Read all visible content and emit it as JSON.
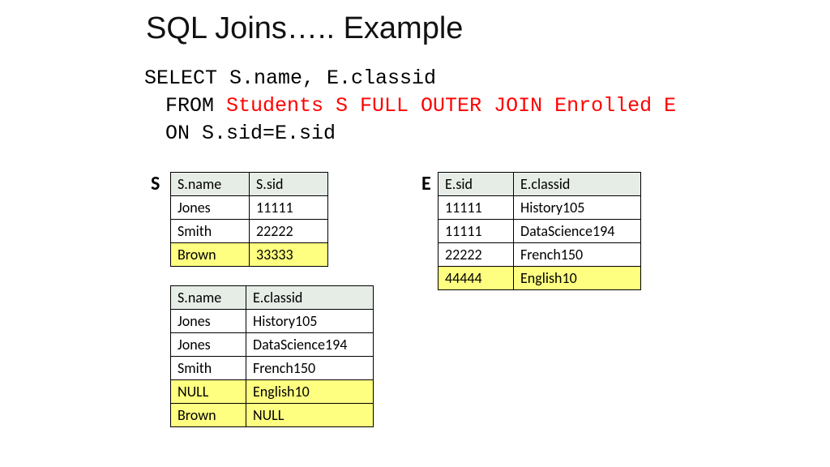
{
  "title": "SQL Joins….. Example",
  "code": {
    "select": "SELECT S.name, E.classid",
    "from_kw": "FROM ",
    "from_red": "Students S FULL OUTER JOIN Enrolled E",
    "on": "ON S.sid=E.sid"
  },
  "labels": {
    "s": "S",
    "e": "E"
  },
  "tables": {
    "students": {
      "headers": [
        "S.name",
        "S.sid"
      ],
      "rows": [
        {
          "cells": [
            "Jones",
            "11111"
          ],
          "hl": false
        },
        {
          "cells": [
            "Smith",
            "22222"
          ],
          "hl": false
        },
        {
          "cells": [
            "Brown",
            "33333"
          ],
          "hl": true
        }
      ]
    },
    "enrolled": {
      "headers": [
        "E.sid",
        "E.classid"
      ],
      "rows": [
        {
          "cells": [
            "11111",
            "History105"
          ],
          "hl": false
        },
        {
          "cells": [
            "11111",
            "DataScience194"
          ],
          "hl": false
        },
        {
          "cells": [
            "22222",
            "French150"
          ],
          "hl": false
        },
        {
          "cells": [
            "44444",
            "English10"
          ],
          "hl": true
        }
      ]
    },
    "result": {
      "headers": [
        "S.name",
        "E.classid"
      ],
      "rows": [
        {
          "cells": [
            "Jones",
            "History105"
          ],
          "hl": false
        },
        {
          "cells": [
            "Jones",
            "DataScience194"
          ],
          "hl": false
        },
        {
          "cells": [
            "Smith",
            "French150"
          ],
          "hl": false
        },
        {
          "cells": [
            "NULL",
            "English10"
          ],
          "hl": true
        },
        {
          "cells": [
            "Brown",
            "NULL"
          ],
          "hl": true
        }
      ]
    }
  }
}
